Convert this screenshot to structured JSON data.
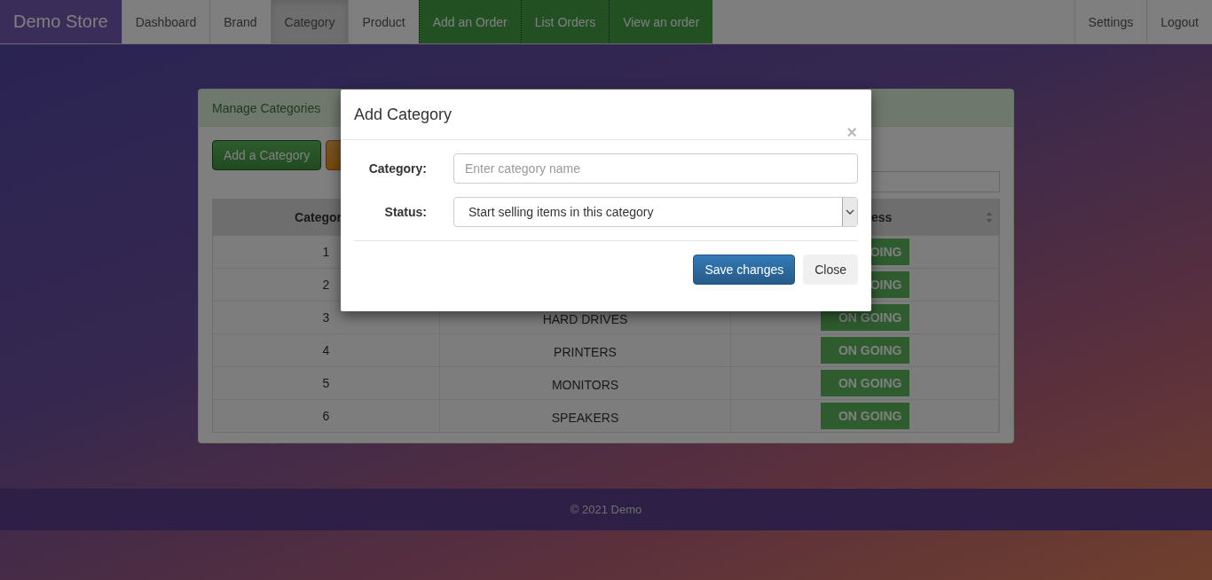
{
  "navbar": {
    "brand": "Demo Store",
    "items": [
      {
        "label": "Dashboard",
        "kind": "plain",
        "selected": false
      },
      {
        "label": "Brand",
        "kind": "plain",
        "selected": false
      },
      {
        "label": "Category",
        "kind": "plain",
        "selected": true
      },
      {
        "label": "Product",
        "kind": "plain",
        "selected": false
      },
      {
        "label": "Add an Order",
        "kind": "order",
        "selected": false
      },
      {
        "label": "List Orders",
        "kind": "order",
        "selected": false
      },
      {
        "label": "View an order",
        "kind": "order",
        "selected": false
      }
    ],
    "right_items": [
      "Settings",
      "Logout"
    ]
  },
  "panel": {
    "title": "Manage Categories",
    "buttons": [
      {
        "label": "Add a Category",
        "kind": "success"
      },
      {
        "kind": "warning"
      }
    ],
    "table": {
      "columns": [
        "Categor",
        "",
        "ess"
      ],
      "rows": [
        {
          "id": "1",
          "status": "OING"
        },
        {
          "id": "2",
          "status": "OING"
        },
        {
          "id": "3",
          "name": "HARD DRIVES",
          "status": "ON GOING"
        },
        {
          "id": "4",
          "name": "PRINTERS",
          "status": "ON GOING"
        },
        {
          "id": "5",
          "name": "MONITORS",
          "status": "ON GOING"
        },
        {
          "id": "6",
          "name": "SPEAKERS",
          "status": "ON GOING"
        }
      ]
    }
  },
  "footer": "© 2021 Demo",
  "modal": {
    "title": "Add Category",
    "close": "×",
    "fields": [
      {
        "label": "Category:",
        "kind": "input",
        "placeholder": "Enter category name"
      },
      {
        "label": "Status:",
        "kind": "select",
        "value": "Start selling items in this category"
      }
    ],
    "buttons": [
      {
        "label": "Save changes",
        "kind": "primary"
      },
      {
        "label": "Close",
        "kind": "default"
      }
    ]
  }
}
